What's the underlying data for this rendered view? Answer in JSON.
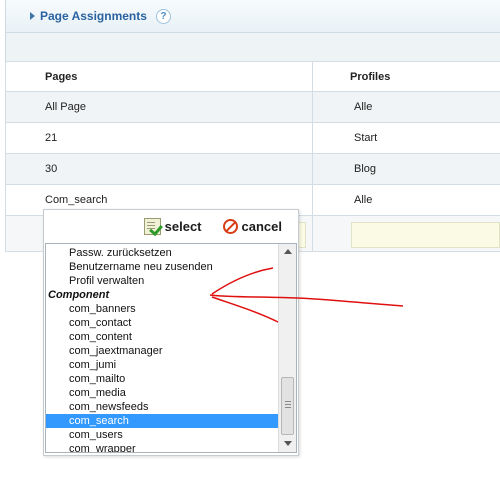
{
  "panel": {
    "title": "Page Assignments",
    "help_icon": "?"
  },
  "table": {
    "headers": [
      "Pages",
      "Profiles"
    ],
    "rows": [
      {
        "page": "All Page",
        "profile": "Alle"
      },
      {
        "page": "21",
        "profile": "Start"
      },
      {
        "page": "30",
        "profile": "Blog"
      },
      {
        "page": "Com_search",
        "profile": "Alle"
      }
    ]
  },
  "popup": {
    "select_label": "select",
    "cancel_label": "cancel",
    "list_items": [
      {
        "label": "Passw. zurücksetzen",
        "type": "item"
      },
      {
        "label": "Benutzername neu zusenden",
        "type": "item"
      },
      {
        "label": "Profil verwalten",
        "type": "item"
      },
      {
        "label": "Component",
        "type": "group"
      },
      {
        "label": "com_banners",
        "type": "item"
      },
      {
        "label": "com_contact",
        "type": "item"
      },
      {
        "label": "com_content",
        "type": "item"
      },
      {
        "label": "com_jaextmanager",
        "type": "item"
      },
      {
        "label": "com_jumi",
        "type": "item"
      },
      {
        "label": "com_mailto",
        "type": "item"
      },
      {
        "label": "com_media",
        "type": "item"
      },
      {
        "label": "com_newsfeeds",
        "type": "item"
      },
      {
        "label": "com_search",
        "type": "item",
        "selected": true
      },
      {
        "label": "com_users",
        "type": "item"
      },
      {
        "label": "com_wrapper",
        "type": "item"
      }
    ]
  },
  "colors": {
    "title": "#2a62a0",
    "selected_row": "#3399ff",
    "annotation": "#e01010",
    "cancel_icon": "#d93b14",
    "select_icon": "#2f9a2a"
  }
}
